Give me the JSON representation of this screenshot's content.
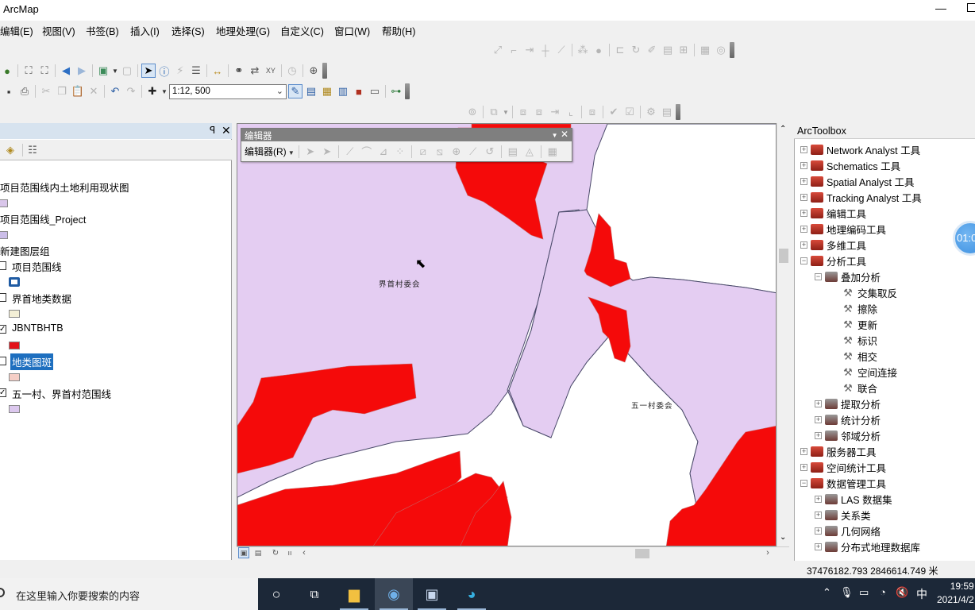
{
  "window": {
    "title": "ArcMap",
    "minimize": "—"
  },
  "menu": [
    "编辑(E)",
    "视图(V)",
    "书签(B)",
    "插入(I)",
    "选择(S)",
    "地理处理(G)",
    "自定义(C)",
    "窗口(W)",
    "帮助(H)"
  ],
  "toolbar": {
    "scale_value": "1:12, 500",
    "tools_row1": [
      "globe-icon",
      "zoom-in-fixed-icon",
      "zoom-out-fixed-icon",
      "back-icon",
      "forward-icon",
      "select-features-icon",
      "clear-selection-icon",
      "select-elements-icon",
      "identify-icon",
      "hyperlink-icon",
      "html-popup-icon",
      "measure-icon",
      "find-icon",
      "find-route-icon",
      "go-to-xy-icon",
      "time-slider-icon",
      "magnifier-icon"
    ],
    "tools_row2": [
      "save-icon",
      "print-icon",
      "cut-icon",
      "copy-icon",
      "paste-icon",
      "delete-icon",
      "undo-icon",
      "redo-icon",
      "add-data-icon"
    ]
  },
  "toc": {
    "pin": "ꟼ",
    "close": "✕",
    "items": [
      {
        "label": "项目范围线内土地利用现状图",
        "swatch": "#d9c6ea",
        "checkbox": null
      },
      {
        "label": "项目范围线_Project",
        "swatch": "#cbbde8",
        "checkbox": null
      },
      {
        "label": "新建图层组",
        "swatch": null,
        "checkbox": null
      },
      {
        "label": "项目范围线",
        "swatch": "outline-blue",
        "checked": false
      },
      {
        "label": "界首地类数据",
        "swatch": "#f3efd6",
        "checked": false
      },
      {
        "label": "JBNTBHTB",
        "swatch": "#e3121a",
        "checked": true
      },
      {
        "label": "地类图斑",
        "swatch": "#f5cec6",
        "checked": false,
        "selected": true
      },
      {
        "label": "五一村、界首村范围线",
        "swatch": "#dcc8ee",
        "checked": true
      }
    ]
  },
  "editor": {
    "title": "编辑器",
    "menu_label": "编辑器(R)",
    "close": "✕"
  },
  "map": {
    "labels": [
      "界首村委会",
      "五一村委会"
    ],
    "colors": {
      "background": "#e4cdf2",
      "parcel": "#f50a0a",
      "river": "#ffffff"
    }
  },
  "toolbox": {
    "title": "ArcToolbox",
    "items": [
      {
        "label": "Network Analyst 工具",
        "level": 0,
        "expand": "+",
        "icon": "box"
      },
      {
        "label": "Schematics 工具",
        "level": 0,
        "expand": "+",
        "icon": "box"
      },
      {
        "label": "Spatial Analyst 工具",
        "level": 0,
        "expand": "+",
        "icon": "box"
      },
      {
        "label": "Tracking Analyst 工具",
        "level": 0,
        "expand": "+",
        "icon": "box"
      },
      {
        "label": "编辑工具",
        "level": 0,
        "expand": "+",
        "icon": "box"
      },
      {
        "label": "地理编码工具",
        "level": 0,
        "expand": "+",
        "icon": "box"
      },
      {
        "label": "多维工具",
        "level": 0,
        "expand": "+",
        "icon": "box"
      },
      {
        "label": "分析工具",
        "level": 0,
        "expand": "−",
        "icon": "box"
      },
      {
        "label": "叠加分析",
        "level": 1,
        "expand": "−",
        "icon": "set"
      },
      {
        "label": "交集取反",
        "level": 2,
        "expand": null,
        "icon": "hammer"
      },
      {
        "label": "擦除",
        "level": 2,
        "expand": null,
        "icon": "hammer"
      },
      {
        "label": "更新",
        "level": 2,
        "expand": null,
        "icon": "hammer"
      },
      {
        "label": "标识",
        "level": 2,
        "expand": null,
        "icon": "hammer"
      },
      {
        "label": "相交",
        "level": 2,
        "expand": null,
        "icon": "hammer"
      },
      {
        "label": "空间连接",
        "level": 2,
        "expand": null,
        "icon": "hammer"
      },
      {
        "label": "联合",
        "level": 2,
        "expand": null,
        "icon": "hammer"
      },
      {
        "label": "提取分析",
        "level": 1,
        "expand": "+",
        "icon": "set"
      },
      {
        "label": "统计分析",
        "level": 1,
        "expand": "+",
        "icon": "set"
      },
      {
        "label": "邻域分析",
        "level": 1,
        "expand": "+",
        "icon": "set"
      },
      {
        "label": "服务器工具",
        "level": 0,
        "expand": "+",
        "icon": "box"
      },
      {
        "label": "空间统计工具",
        "level": 0,
        "expand": "+",
        "icon": "box"
      },
      {
        "label": "数据管理工具",
        "level": 0,
        "expand": "−",
        "icon": "box"
      },
      {
        "label": "LAS 数据集",
        "level": 1,
        "expand": "+",
        "icon": "set"
      },
      {
        "label": "关系类",
        "level": 1,
        "expand": "+",
        "icon": "set"
      },
      {
        "label": "几何网络",
        "level": 1,
        "expand": "+",
        "icon": "set"
      },
      {
        "label": "分布式地理数据库",
        "level": 1,
        "expand": "+",
        "icon": "set"
      }
    ]
  },
  "status": {
    "coordinates": "37476182.793  2846614.749 米"
  },
  "timer_badge": "01:0",
  "taskbar": {
    "search_placeholder": "在这里输入你要搜索的内容",
    "time": "19:59",
    "date": "2021/4/2",
    "ime": "中"
  }
}
